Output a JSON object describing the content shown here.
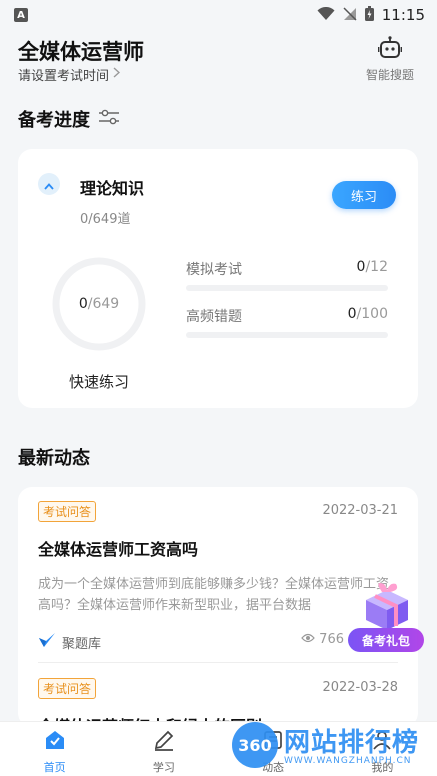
{
  "status_bar": {
    "time": "11:15",
    "app_badge": "A"
  },
  "header": {
    "title": "全媒体运营师",
    "subtitle": "请设置考试时间",
    "ai_search_label": "智能搜题"
  },
  "progress_section": {
    "title": "备考进度",
    "subject": "理论知识",
    "subject_count": "0/649道",
    "practice_button": "练习",
    "ring": {
      "done": "0",
      "total": "/649",
      "progress": 0
    },
    "quick_practice": "快速练习",
    "stats": [
      {
        "name": "模拟考试",
        "done": "0",
        "total": "/12",
        "progress": 0
      },
      {
        "name": "高频错题",
        "done": "0",
        "total": "/100",
        "progress": 0
      }
    ]
  },
  "news_section": {
    "title": "最新动态",
    "items": [
      {
        "tag": "考试问答",
        "date": "2022-03-21",
        "title": "全媒体运营师工资高吗",
        "summary": "成为一个全媒体运营师到底能够赚多少钱？全媒体运营师工资高吗？全媒体运营师作来新型职业，据平台数据",
        "source": "聚题库",
        "views": "766"
      },
      {
        "tag": "考试问答",
        "date": "2022-03-28",
        "title": "全媒体运营师红本和绿本的区别"
      }
    ]
  },
  "gift": {
    "label": "备考礼包"
  },
  "tabbar": {
    "tabs": [
      {
        "label": "首页",
        "icon": "home-icon"
      },
      {
        "label": "学习",
        "icon": "pen-icon"
      },
      {
        "label": "动态",
        "icon": "news-icon"
      },
      {
        "label": "我的",
        "icon": "user-icon"
      }
    ]
  },
  "watermark": {
    "circle": "360",
    "main": "网站排行榜",
    "sub": "WWW.WANGZHANPH.CN"
  },
  "colors": {
    "accent": "#2b8cf6",
    "tag": "#e8901c",
    "gift": "#8a4ff0"
  }
}
